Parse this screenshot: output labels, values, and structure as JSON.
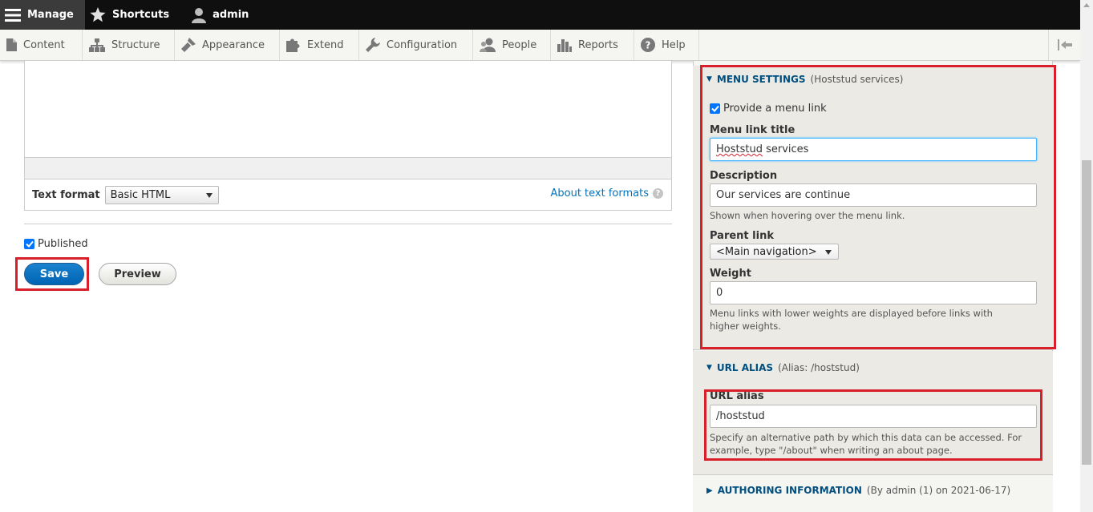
{
  "toolbar": {
    "manage_label": "Manage",
    "shortcuts_label": "Shortcuts",
    "user_label": "admin"
  },
  "admin_menu": {
    "items": [
      {
        "label": "Content",
        "icon": "file-icon"
      },
      {
        "label": "Structure",
        "icon": "sitemap-icon"
      },
      {
        "label": "Appearance",
        "icon": "brush-icon"
      },
      {
        "label": "Extend",
        "icon": "puzzle-icon"
      },
      {
        "label": "Configuration",
        "icon": "wrench-icon"
      },
      {
        "label": "People",
        "icon": "people-icon"
      },
      {
        "label": "Reports",
        "icon": "bar-chart-icon"
      },
      {
        "label": "Help",
        "icon": "help-icon"
      }
    ]
  },
  "editor": {
    "text_format_label": "Text format",
    "text_format_value": "Basic HTML",
    "about_link": "About text formats"
  },
  "form": {
    "published_label": "Published",
    "published_checked": true,
    "save_label": "Save",
    "preview_label": "Preview"
  },
  "menu_settings": {
    "title": "MENU SETTINGS",
    "summary": "(Hoststud services)",
    "provide_link_label": "Provide a menu link",
    "provide_link_checked": true,
    "link_title_label": "Menu link title",
    "link_title_value_misspelled": "Hoststud",
    "link_title_value_rest": " services",
    "description_label": "Description",
    "description_value": "Our services are continue",
    "description_help": "Shown when hovering over the menu link.",
    "parent_label": "Parent link",
    "parent_value": "<Main navigation>",
    "weight_label": "Weight",
    "weight_value": "0",
    "weight_help_line1": "Menu links with lower weights are displayed before links with",
    "weight_help_line2": "higher weights."
  },
  "url_alias": {
    "title": "URL ALIAS",
    "summary": "(Alias: /hoststud)",
    "label": "URL alias",
    "value": "/hoststud",
    "help_line1": "Specify an alternative path by which this data can be accessed. For",
    "help_line2": "example, type \"/about\" when writing an about page."
  },
  "authoring": {
    "title": "AUTHORING INFORMATION",
    "summary": "(By admin (1) on 2021-06-17)"
  },
  "colors": {
    "highlight": "#d9202a",
    "link": "#0074bd",
    "primary_button": "#0071b8"
  }
}
